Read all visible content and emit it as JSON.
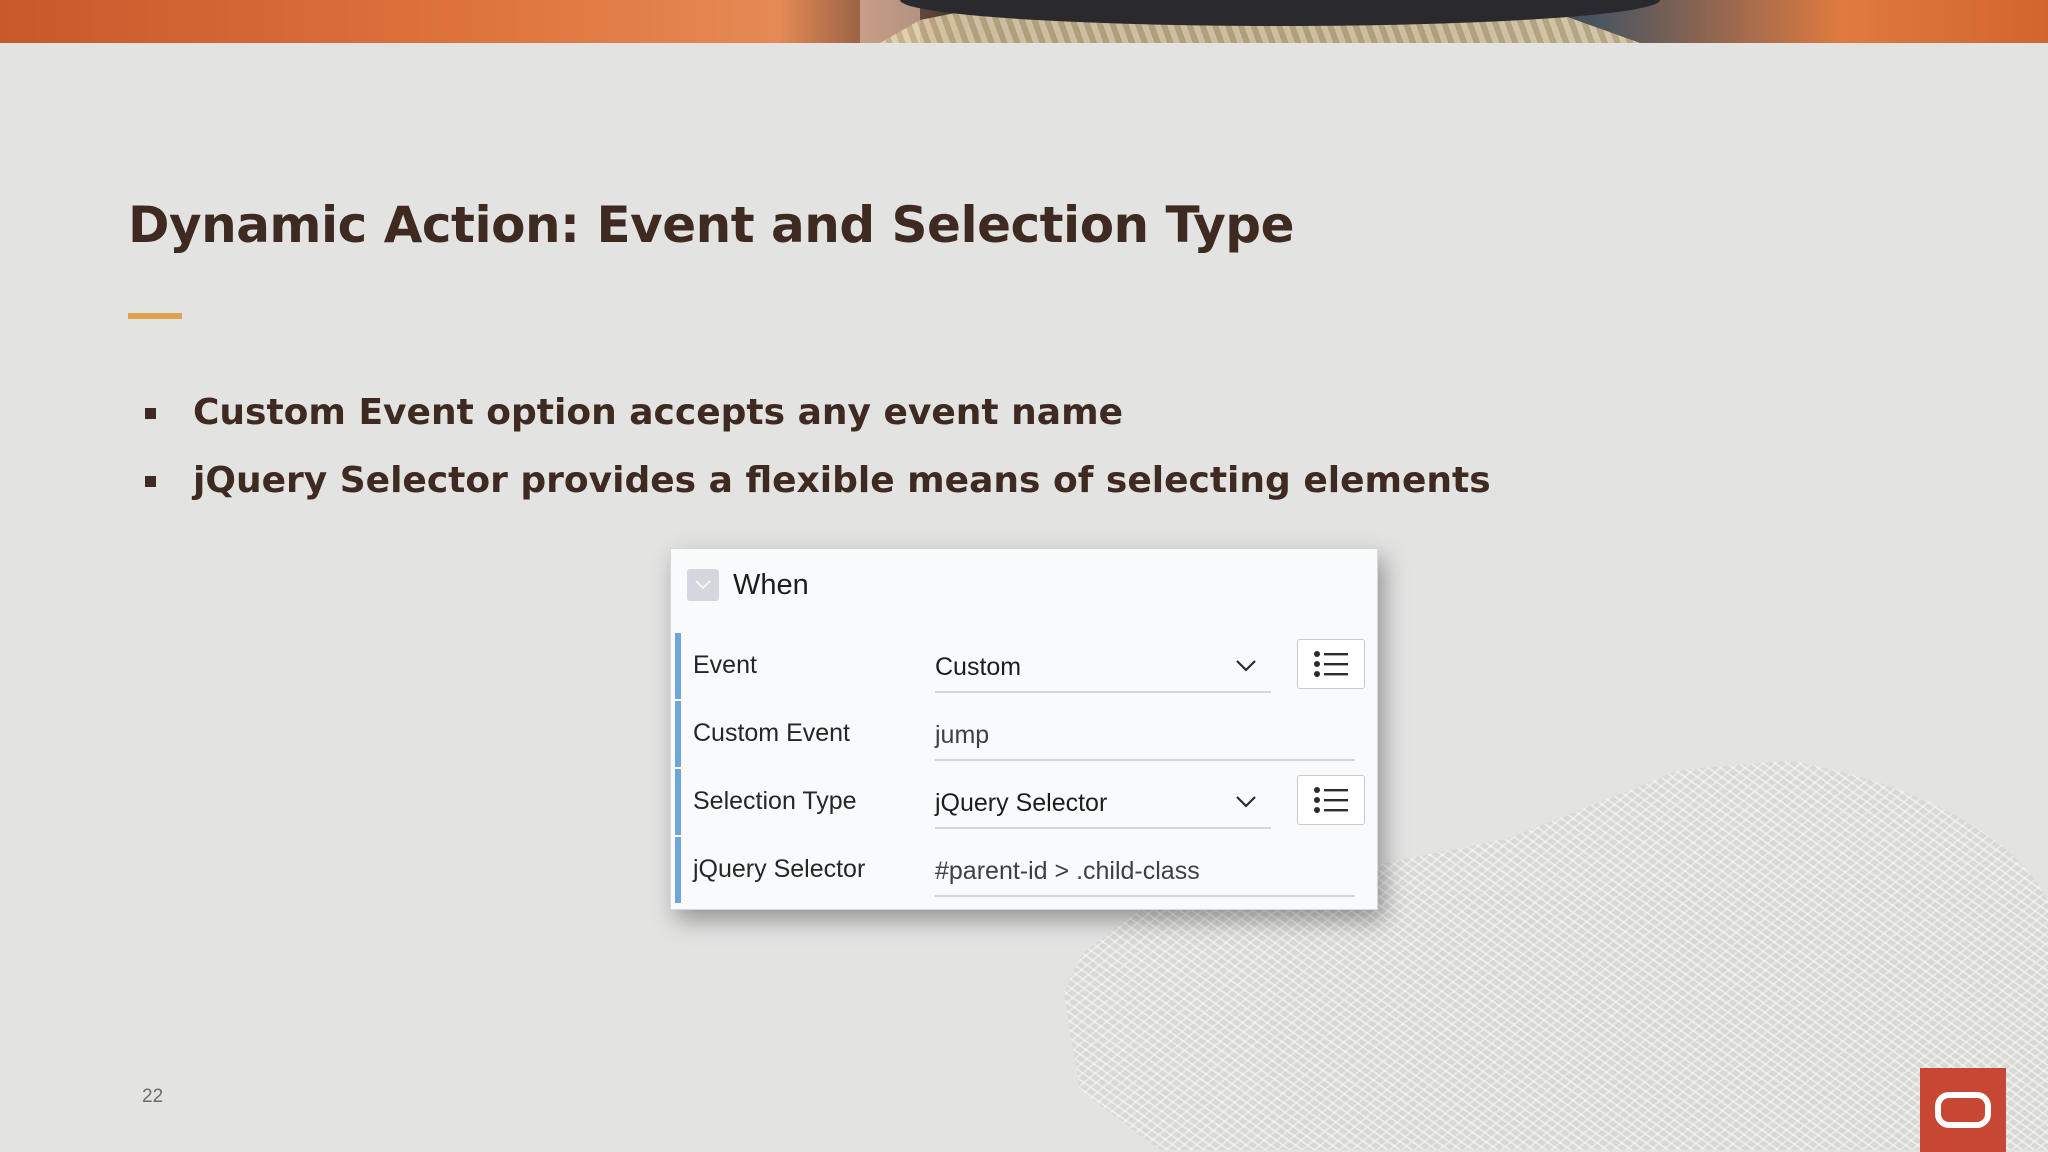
{
  "slide": {
    "title": "Dynamic Action: Event and Selection Type",
    "bullets": [
      "Custom Event option accepts any event name",
      "jQuery Selector provides a flexible means of selecting elements"
    ],
    "page_number": "22"
  },
  "panel": {
    "title": "When",
    "rows": [
      {
        "label": "Event",
        "value": "Custom"
      },
      {
        "label": "Custom Event",
        "value": "jump"
      },
      {
        "label": "Selection Type",
        "value": "jQuery Selector"
      },
      {
        "label": "jQuery Selector",
        "value": "#parent-id > .child-class"
      }
    ]
  },
  "colors": {
    "title": "#3f2a22",
    "accent_rule": "#e0a24e",
    "row_bar": "#6ea7d6",
    "logo": "#c74634"
  },
  "icons": {
    "collapse": "chevron-down-icon",
    "list": "list-icon",
    "logo": "oracle-logo"
  }
}
